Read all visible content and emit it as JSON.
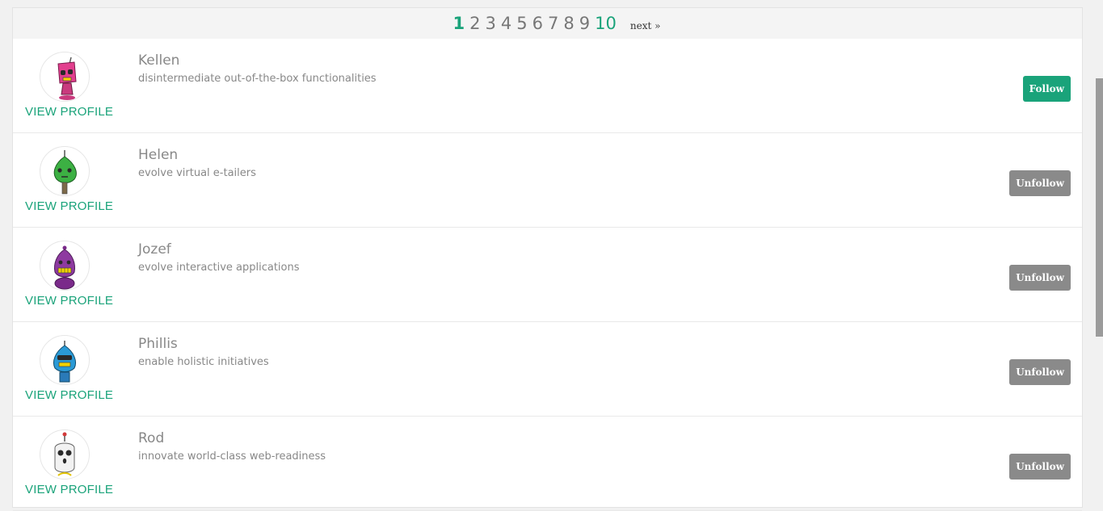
{
  "pagination": {
    "pages": [
      "1",
      "2",
      "3",
      "4",
      "5",
      "6",
      "7",
      "8",
      "9",
      "10"
    ],
    "current": "1",
    "next_label": "next »"
  },
  "colors": {
    "accent": "#1aa37a",
    "unfollow_button": "#8a8a8a",
    "text_muted": "#888888"
  },
  "users": [
    {
      "name": "Kellen",
      "tagline": "disintermediate out-of-the-box functionalities",
      "view_profile_label": "VIEW PROFILE",
      "button_label": "Follow",
      "avatar_icon": "pink-robot-icon"
    },
    {
      "name": "Helen",
      "tagline": "evolve virtual e-tailers",
      "view_profile_label": "VIEW PROFILE",
      "button_label": "Unfollow",
      "avatar_icon": "green-robot-icon"
    },
    {
      "name": "Jozef",
      "tagline": "evolve interactive applications",
      "view_profile_label": "VIEW PROFILE",
      "button_label": "Unfollow",
      "avatar_icon": "purple-robot-icon"
    },
    {
      "name": "Phillis",
      "tagline": "enable holistic initiatives",
      "view_profile_label": "VIEW PROFILE",
      "button_label": "Unfollow",
      "avatar_icon": "blue-robot-icon"
    },
    {
      "name": "Rod",
      "tagline": "innovate world-class web-readiness",
      "view_profile_label": "VIEW PROFILE",
      "button_label": "Unfollow",
      "avatar_icon": "white-robot-icon"
    }
  ]
}
